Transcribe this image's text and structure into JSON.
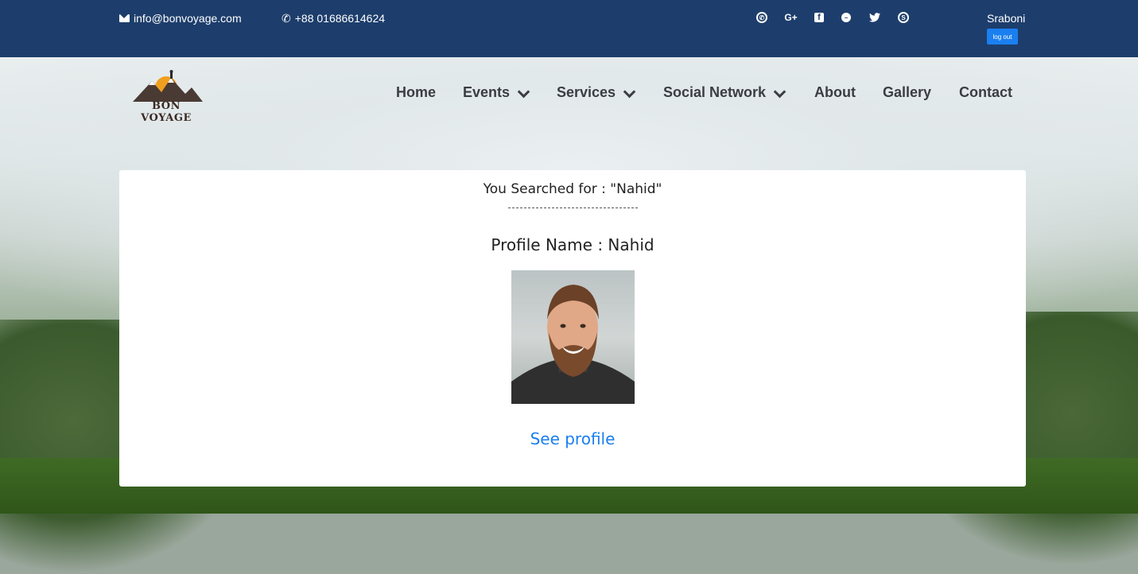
{
  "topbar": {
    "email": "info@bonvoyage.com",
    "phone": "+88 01686614624",
    "socials": [
      {
        "icon": "viber-icon",
        "glyph": "✆"
      },
      {
        "icon": "google-plus-icon",
        "glyph": "G+"
      },
      {
        "icon": "facebook-icon",
        "glyph": "f"
      },
      {
        "icon": "messenger-icon",
        "glyph": "~"
      },
      {
        "icon": "twitter-icon",
        "glyph": "🐦"
      },
      {
        "icon": "skype-icon",
        "glyph": "S"
      }
    ],
    "user_name": "Sraboni",
    "logout_label": "log out"
  },
  "logo": {
    "text": "BON VOYAGE"
  },
  "nav": {
    "home": "Home",
    "events": "Events",
    "services": "Services",
    "social_network": "Social Network",
    "about": "About",
    "gallery": "Gallery",
    "contact": "Contact"
  },
  "result": {
    "search_title": "You Searched for : \"Nahid\"",
    "profile_title": "Profile Name : Nahid",
    "see_profile": "See profile"
  },
  "colors": {
    "topbar_bg": "#1d3e6c",
    "accent": "#1a7ff0"
  }
}
